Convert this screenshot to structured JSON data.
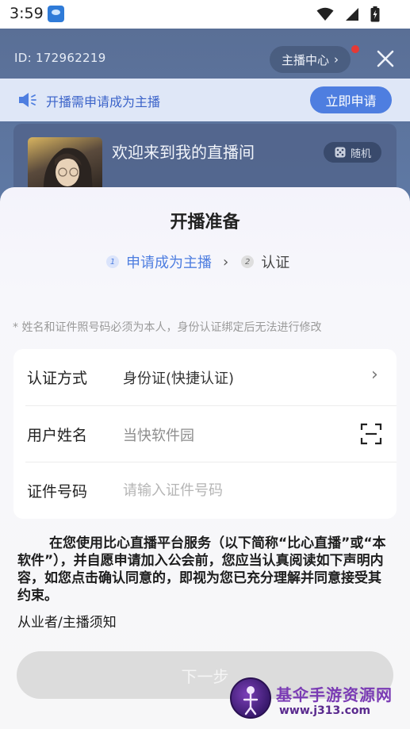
{
  "status_bar": {
    "time": "3:59"
  },
  "header": {
    "id_text": "ID: 172962219",
    "host_center_label": "主播中心",
    "host_center_chevron": "›"
  },
  "notice": {
    "text": "开播需申请成为主播",
    "apply_label": "立即申请"
  },
  "room": {
    "title": "欢迎来到我的直播间",
    "random_label": "随机"
  },
  "sheet": {
    "title": "开播准备",
    "steps": [
      {
        "num": "1",
        "label": "申请成为主播"
      },
      {
        "num": "2",
        "label": "认证"
      }
    ],
    "step_arrow": "›",
    "hint": "* 姓名和证件照号码必须为本人，身份认证绑定后无法进行修改",
    "form": {
      "rows": [
        {
          "label": "认证方式",
          "value": "身份证(快捷认证)"
        },
        {
          "label": "用户姓名",
          "value": "当快软件园"
        },
        {
          "label": "证件号码",
          "placeholder": "请输入证件号码"
        }
      ],
      "chevron": "›"
    },
    "agreement": "在您使用比心直播平台服务（以下简称“比心直播”或“本软件”），并自愿申请加入公会前，您应当认真阅读如下声明内容，如您点击确认同意的，即视为您已充分理解并同意接受其约束。",
    "agreement_link": "从业者/主播须知",
    "next_label": "下一步"
  },
  "watermark": {
    "title": "基伞手游资源网",
    "url": "www.j313.com"
  },
  "colors": {
    "accent": "#4e7ee0",
    "notice_bg": "#dfe7f7",
    "live_bg": "#5f7aa6",
    "disabled_button": "#dcdcdc",
    "badge_red": "#e53935"
  },
  "icons": {
    "app": "app-logo-icon",
    "wifi": "wifi-icon",
    "signal": "cell-signal-icon",
    "battery": "battery-charging-icon",
    "close": "close-icon",
    "speaker": "speaker-icon",
    "dice": "dice-icon",
    "scan": "scan-icon",
    "chevron": "chevron-right-icon"
  }
}
